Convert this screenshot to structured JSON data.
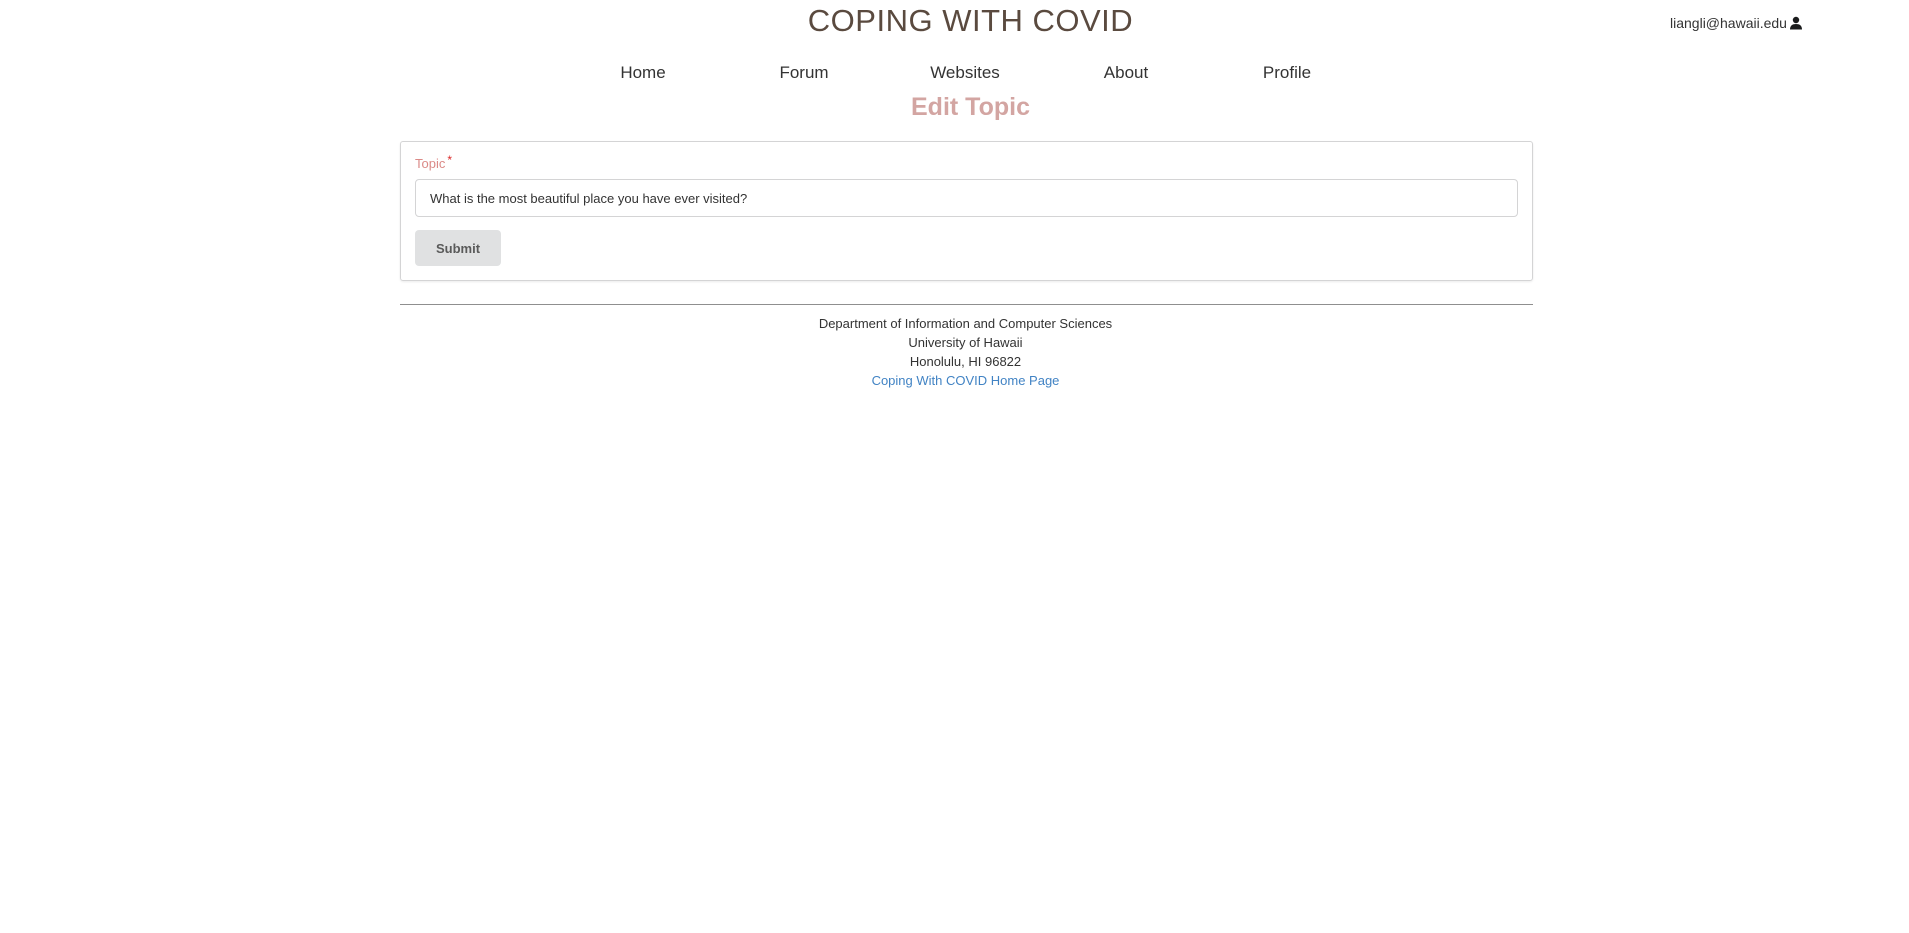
{
  "header": {
    "site_title": "COPING WITH COVID",
    "user_email": "liangli@hawaii.edu",
    "user_icon": "user-icon"
  },
  "nav": {
    "items": [
      {
        "label": "Home"
      },
      {
        "label": "Forum"
      },
      {
        "label": "Websites"
      },
      {
        "label": "About"
      },
      {
        "label": "Profile"
      }
    ]
  },
  "page": {
    "heading": "Edit Topic"
  },
  "form": {
    "topic_label": "Topic",
    "required_marker": "*",
    "topic_value": "What is the most beautiful place you have ever visited?",
    "submit_label": "Submit"
  },
  "footer": {
    "line1": "Department of Information and Computer Sciences",
    "line2": "University of Hawaii",
    "line3": "Honolulu, HI 96822",
    "home_link": "Coping With COVID Home Page"
  },
  "colors": {
    "title": "#5a4a3f",
    "heading_accent": "#d3a5a2",
    "label_accent": "#db8a87",
    "required": "#db2828",
    "link": "#4183c4",
    "button_bg": "#e0e1e2"
  }
}
